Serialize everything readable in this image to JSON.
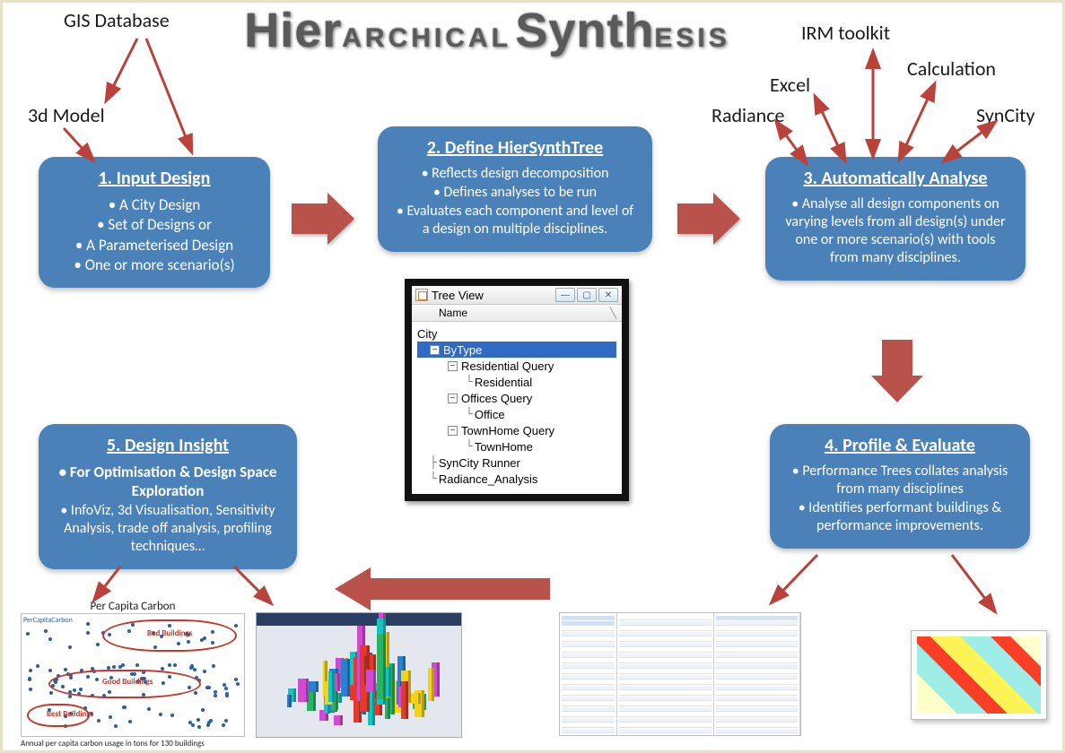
{
  "title": {
    "h1": "Hier",
    "h2": "ARCHICAL",
    "s1": "Synth",
    "s2": "ESIS"
  },
  "labels": {
    "gis": "GIS Database",
    "model3d": "3d Model",
    "irm": "IRM toolkit",
    "excel": "Excel",
    "radiance": "Radiance",
    "calculation": "Calculation",
    "syncity": "SynCity"
  },
  "boxes": {
    "b1": {
      "hdr": "1. Input Design",
      "items": [
        "A City Design",
        "Set of Designs or",
        "A Parameterised Design",
        "One or more scenario(s)"
      ]
    },
    "b2": {
      "hdr": "2. Define HierSynthTree",
      "items": [
        "Reflects design decomposition",
        "Defines analyses to be run",
        "Evaluates each component and level of a design on multiple disciplines."
      ]
    },
    "b3": {
      "hdr": "3. Automatically Analyse",
      "items": [
        "Analyse all design components on varying levels from all design(s) under one or more scenario(s) with tools from many disciplines."
      ]
    },
    "b4": {
      "hdr": "4.  Profile & Evaluate",
      "items": [
        "Performance Trees collates analysis from many disciplines",
        "Identifies performant buildings & performance improvements."
      ]
    },
    "b5": {
      "hdr": "5. Design Insight",
      "sub": "For Optimisation & Design Space Exploration",
      "items": [
        "InfoViz, 3d Visualisation, Sensitivity Analysis, trade off analysis, profiling techniques…"
      ]
    }
  },
  "tree": {
    "title": "Tree View",
    "col": "Name",
    "btn_min": "—",
    "btn_max": "▢",
    "btn_close": "✕",
    "n_city": "City",
    "n_bytype": "ByType",
    "n_resq": "Residential Query",
    "n_res": "Residential",
    "n_offq": "Offices Query",
    "n_off": "Office",
    "n_thq": "TownHome Query",
    "n_th": "TownHome",
    "n_sync": "SynCity Runner",
    "n_rad": "Radiance_Analysis"
  },
  "scatter": {
    "title": "Per Capita Carbon",
    "series": "PerCapitaCarbon",
    "r1": "Bad Buildings",
    "r2": "Good Buildings",
    "r3": "Best Buildings",
    "xlabel": "Annual per capita carbon usage in tons for 130 buildings"
  }
}
